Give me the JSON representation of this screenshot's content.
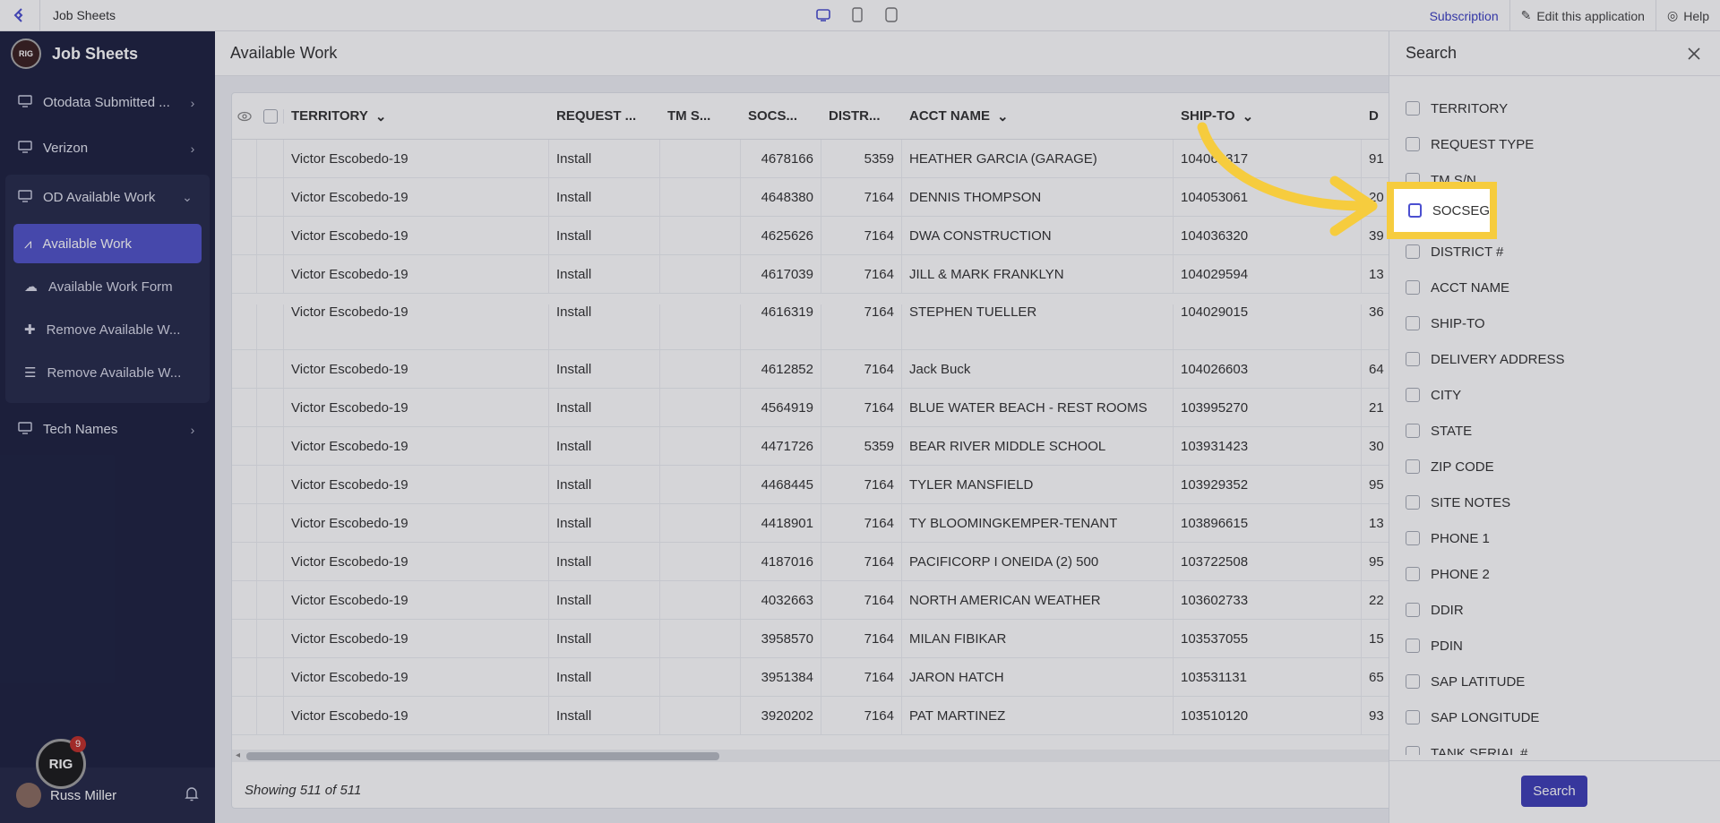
{
  "topbar": {
    "app_title": "Job Sheets",
    "subscription": "Subscription",
    "edit_app": "Edit this application",
    "help": "Help"
  },
  "sidebar": {
    "title": "Job Sheets",
    "logo_text": "RIG",
    "items": [
      {
        "label": "Otodata Submitted ..."
      },
      {
        "label": "Verizon"
      },
      {
        "label": "OD Available Work"
      },
      {
        "label": "Tech Names"
      }
    ],
    "sub_items": [
      {
        "label": "Available Work"
      },
      {
        "label": "Available Work Form"
      },
      {
        "label": "Remove Available W..."
      },
      {
        "label": "Remove Available W..."
      }
    ],
    "user": "Russ Miller",
    "chat_logo": "RIG",
    "chat_badge": "9"
  },
  "main": {
    "page_title": "Available Work",
    "columns": [
      "TERRITORY",
      "REQUEST ...",
      "TM S...",
      "SOCS...",
      "DISTR...",
      "ACCT NAME",
      "SHIP-TO",
      "D"
    ],
    "rows": [
      {
        "territory": "Victor Escobedo-19",
        "request": "Install",
        "socs": "4678166",
        "distr": "5359",
        "acct": "HEATHER GARCIA (GARAGE)",
        "ship": "104063317",
        "d": "91"
      },
      {
        "territory": "Victor Escobedo-19",
        "request": "Install",
        "socs": "4648380",
        "distr": "7164",
        "acct": "DENNIS THOMPSON",
        "ship": "104053061",
        "d": "20"
      },
      {
        "territory": "Victor Escobedo-19",
        "request": "Install",
        "socs": "4625626",
        "distr": "7164",
        "acct": "DWA CONSTRUCTION",
        "ship": "104036320",
        "d": "39"
      },
      {
        "territory": "Victor Escobedo-19",
        "request": "Install",
        "socs": "4617039",
        "distr": "7164",
        "acct": "JILL & MARK FRANKLYN",
        "ship": "104029594",
        "d": "13"
      },
      {
        "territory": "Victor Escobedo-19",
        "request": "Install",
        "socs": "4616319",
        "distr": "7164",
        "acct": "STEPHEN TUELLER",
        "ship": "104029015",
        "d": "36"
      },
      {
        "territory": "Victor Escobedo-19",
        "request": "Install",
        "socs": "4612852",
        "distr": "7164",
        "acct": "Jack Buck",
        "ship": "104026603",
        "d": "64"
      },
      {
        "territory": "Victor Escobedo-19",
        "request": "Install",
        "socs": "4564919",
        "distr": "7164",
        "acct": "BLUE WATER BEACH - REST ROOMS",
        "ship": "103995270",
        "d": "21"
      },
      {
        "territory": "Victor Escobedo-19",
        "request": "Install",
        "socs": "4471726",
        "distr": "5359",
        "acct": "BEAR RIVER MIDDLE SCHOOL",
        "ship": "103931423",
        "d": "30"
      },
      {
        "territory": "Victor Escobedo-19",
        "request": "Install",
        "socs": "4468445",
        "distr": "7164",
        "acct": "TYLER MANSFIELD",
        "ship": "103929352",
        "d": "95"
      },
      {
        "territory": "Victor Escobedo-19",
        "request": "Install",
        "socs": "4418901",
        "distr": "7164",
        "acct": "TY BLOOMINGKEMPER-TENANT",
        "ship": "103896615",
        "d": "13"
      },
      {
        "territory": "Victor Escobedo-19",
        "request": "Install",
        "socs": "4187016",
        "distr": "7164",
        "acct": "PACIFICORP I ONEIDA (2) 500",
        "ship": "103722508",
        "d": "95"
      },
      {
        "territory": "Victor Escobedo-19",
        "request": "Install",
        "socs": "4032663",
        "distr": "7164",
        "acct": "NORTH AMERICAN WEATHER",
        "ship": "103602733",
        "d": "22"
      },
      {
        "territory": "Victor Escobedo-19",
        "request": "Install",
        "socs": "3958570",
        "distr": "7164",
        "acct": "MILAN FIBIKAR",
        "ship": "103537055",
        "d": "15"
      },
      {
        "territory": "Victor Escobedo-19",
        "request": "Install",
        "socs": "3951384",
        "distr": "7164",
        "acct": "JARON HATCH",
        "ship": "103531131",
        "d": "65"
      },
      {
        "territory": "Victor Escobedo-19",
        "request": "Install",
        "socs": "3920202",
        "distr": "7164",
        "acct": "PAT MARTINEZ",
        "ship": "103510120",
        "d": "93"
      }
    ],
    "showing": "Showing 511 of 511"
  },
  "search_panel": {
    "title": "Search",
    "fields": [
      "TERRITORY",
      "REQUEST TYPE",
      "TM S/N",
      "SOCSEG",
      "DISTRICT #",
      "ACCT NAME",
      "SHIP-TO",
      "DELIVERY ADDRESS",
      "CITY",
      "STATE",
      "ZIP CODE",
      "SITE NOTES",
      "PHONE 1",
      "PHONE 2",
      "DDIR",
      "PDIN",
      "SAP LATITUDE",
      "SAP LONGITUDE",
      "TANK SERIAL #"
    ],
    "highlighted_field": "SOCSEG",
    "search_button": "Search"
  },
  "colors": {
    "sidebar_bg": "#1e2240",
    "accent": "#5153c8",
    "highlight": "#f6cc3e"
  }
}
